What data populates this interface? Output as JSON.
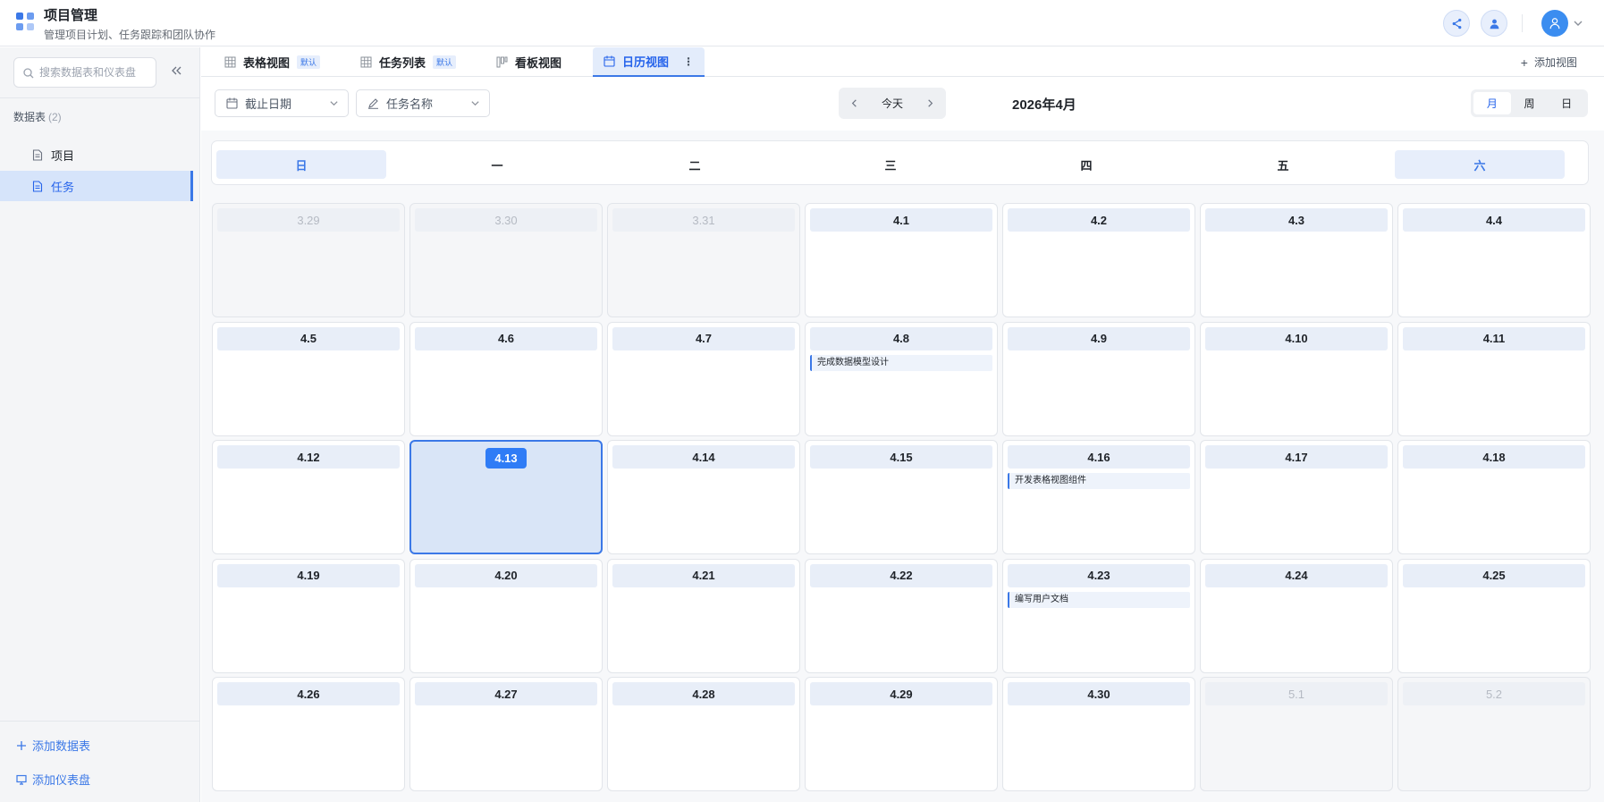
{
  "header": {
    "title": "项目管理",
    "subtitle": "管理项目计划、任务跟踪和团队协作"
  },
  "sidebar": {
    "search_placeholder": "搜索数据表和仪表盘",
    "section_label": "数据表",
    "section_count": "(2)",
    "items": [
      {
        "label": "项目",
        "active": false
      },
      {
        "label": "任务",
        "active": true
      }
    ],
    "add_table": "添加数据表",
    "add_dashboard": "添加仪表盘"
  },
  "tabs": [
    {
      "label": "表格视图",
      "tag": "默认",
      "icon": "table-icon"
    },
    {
      "label": "任务列表",
      "tag": "默认",
      "icon": "table-icon"
    },
    {
      "label": "看板视图",
      "tag": "",
      "icon": "kanban-icon"
    },
    {
      "label": "日历视图",
      "tag": "",
      "icon": "calendar-icon",
      "active": true
    }
  ],
  "add_view": "添加视图",
  "toolbar": {
    "date_field": "截止日期",
    "title_field": "任务名称",
    "today": "今天",
    "month_label": "2026年4月",
    "modes": [
      "月",
      "周",
      "日"
    ],
    "active_mode": "月"
  },
  "calendar": {
    "weekdays": [
      "日",
      "一",
      "二",
      "三",
      "四",
      "五",
      "六"
    ],
    "weeks": [
      [
        {
          "d": "3.29",
          "dim": true
        },
        {
          "d": "3.30",
          "dim": true
        },
        {
          "d": "3.31",
          "dim": true
        },
        {
          "d": "4.1"
        },
        {
          "d": "4.2"
        },
        {
          "d": "4.3"
        },
        {
          "d": "4.4"
        }
      ],
      [
        {
          "d": "4.5"
        },
        {
          "d": "4.6"
        },
        {
          "d": "4.7"
        },
        {
          "d": "4.8",
          "ev": "完成数据模型设计"
        },
        {
          "d": "4.9"
        },
        {
          "d": "4.10"
        },
        {
          "d": "4.11"
        }
      ],
      [
        {
          "d": "4.12"
        },
        {
          "d": "4.13",
          "today": true
        },
        {
          "d": "4.14"
        },
        {
          "d": "4.15"
        },
        {
          "d": "4.16",
          "ev": "开发表格视图组件"
        },
        {
          "d": "4.17"
        },
        {
          "d": "4.18"
        }
      ],
      [
        {
          "d": "4.19"
        },
        {
          "d": "4.20"
        },
        {
          "d": "4.21"
        },
        {
          "d": "4.22"
        },
        {
          "d": "4.23",
          "ev": "编写用户文档"
        },
        {
          "d": "4.24"
        },
        {
          "d": "4.25"
        }
      ],
      [
        {
          "d": "4.26"
        },
        {
          "d": "4.27"
        },
        {
          "d": "4.28"
        },
        {
          "d": "4.29"
        },
        {
          "d": "4.30"
        },
        {
          "d": "5.1",
          "dim": true
        },
        {
          "d": "5.2",
          "dim": true
        }
      ]
    ]
  },
  "colors": {
    "accent": "#3b78e7",
    "today": "#2f7cf6",
    "weekend_head": "#e7eefb"
  }
}
